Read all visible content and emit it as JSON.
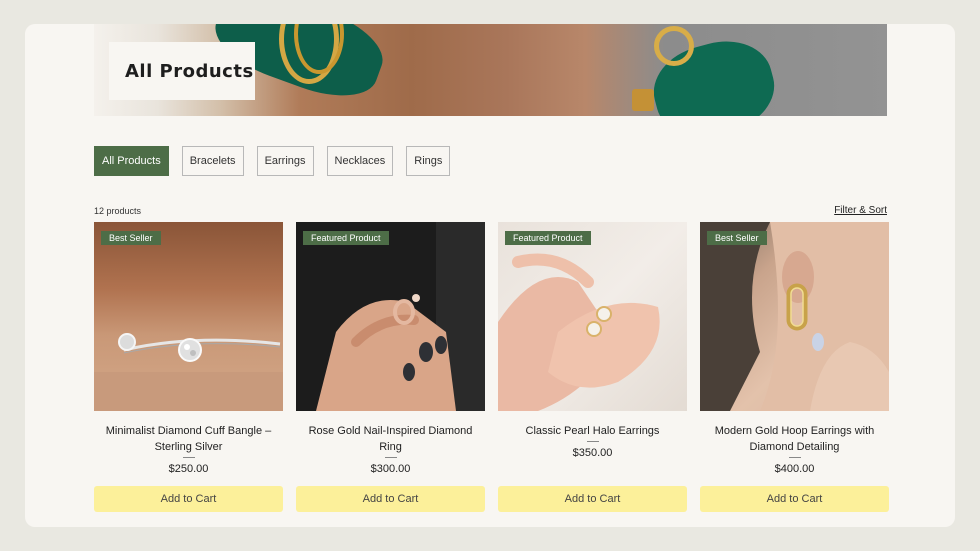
{
  "page": {
    "title": "All Products"
  },
  "filters": [
    {
      "label": "All Products",
      "active": true
    },
    {
      "label": "Bracelets",
      "active": false
    },
    {
      "label": "Earrings",
      "active": false
    },
    {
      "label": "Necklaces",
      "active": false
    },
    {
      "label": "Rings",
      "active": false
    }
  ],
  "listing": {
    "count_label": "12 products",
    "filter_sort_label": "Filter & Sort"
  },
  "products": [
    {
      "badge": "Best Seller",
      "title": "Minimalist Diamond Cuff Bangle – Sterling Silver",
      "price": "$250.00",
      "button": "Add to Cart"
    },
    {
      "badge": "Featured Product",
      "title": "Rose Gold Nail-Inspired Diamond Ring",
      "price": "$300.00",
      "button": "Add to Cart"
    },
    {
      "badge": "Featured Product",
      "title": "Classic Pearl Halo Earrings",
      "price": "$350.00",
      "button": "Add to Cart"
    },
    {
      "badge": "Best Seller",
      "title": "Modern Gold Hoop Earrings with Diamond Detailing",
      "price": "$400.00",
      "button": "Add to Cart"
    }
  ],
  "colors": {
    "accent_green": "#4d6d47",
    "button_yellow": "#fcf09a",
    "page_bg": "#e9e8e1",
    "card_bg": "#f8f6f2"
  }
}
